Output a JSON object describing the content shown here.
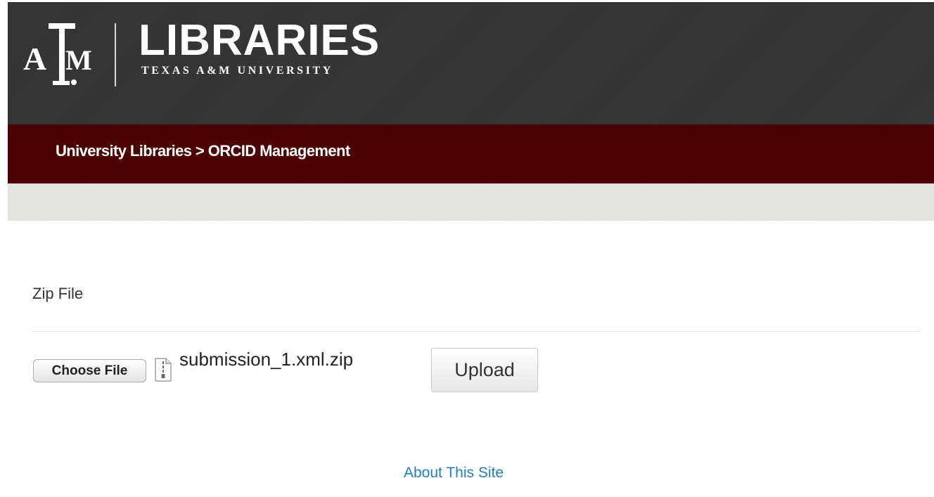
{
  "header": {
    "logo_title": "LIBRARIES",
    "logo_subtitle": "TEXAS A&M UNIVERSITY",
    "logo_mark_letters": [
      "A",
      "T",
      "M"
    ]
  },
  "breadcrumb": {
    "text": "University Libraries > ORCID Management"
  },
  "form": {
    "section_title": "Zip File",
    "choose_file_label": "Choose File",
    "selected_file": "submission_1.xml.zip",
    "upload_label": "Upload"
  },
  "footer": {
    "about_link": "About This Site"
  },
  "colors": {
    "header_bg": "#333333",
    "breadcrumb_bg": "#4d0000",
    "link": "#1f7fbf"
  }
}
